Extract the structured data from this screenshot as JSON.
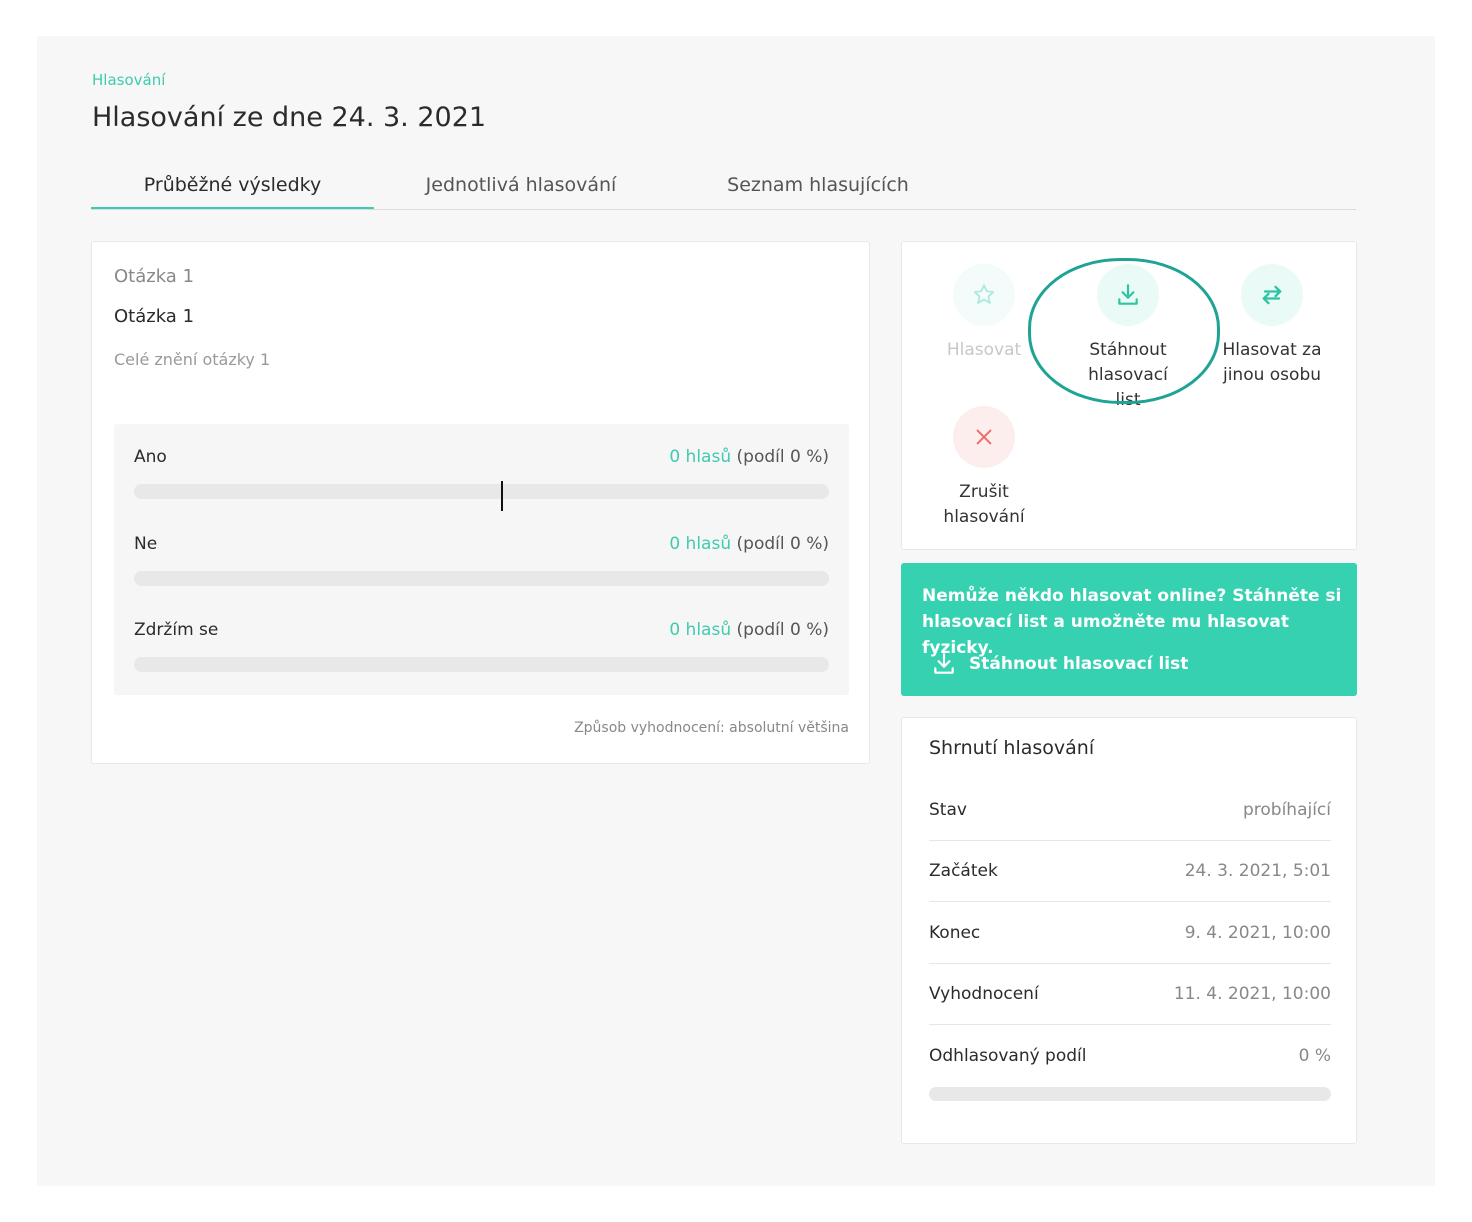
{
  "breadcrumb": "Hlasování",
  "title": "Hlasování ze dne 24. 3. 2021",
  "tabs": [
    {
      "label": "Průběžné výsledky",
      "active": true
    },
    {
      "label": "Jednotlivá hlasování",
      "active": false
    },
    {
      "label": "Seznam hlasujících",
      "active": false
    }
  ],
  "question": {
    "label": "Otázka 1",
    "title": "Otázka 1",
    "description": "Celé znění otázky 1",
    "options": [
      {
        "name": "Ano",
        "votes_link": "0 hlasů",
        "share": "(podíl 0 %)",
        "fraction": 0
      },
      {
        "name": "Ne",
        "votes_link": "0 hlasů",
        "share": "(podíl 0 %)",
        "fraction": 0
      },
      {
        "name": "Zdržím se",
        "votes_link": "0 hlasů",
        "share": "(podíl 0 %)",
        "fraction": 0
      }
    ],
    "method": "Způsob vyhodnocení: absolutní většina"
  },
  "actions": {
    "vote": "Hlasovat",
    "download_line1": "Stáhnout",
    "download_line2": "hlasovací list",
    "proxy_line1": "Hlasovat za",
    "proxy_line2": "jinou osobu",
    "cancel_line1": "Zrušit",
    "cancel_line2": "hlasování"
  },
  "banner": {
    "text": "Nemůže někdo hlasovat online? Stáhněte si hlasovací list a umožněte mu hlasovat fyzicky.",
    "link": "Stáhnout hlasovací list"
  },
  "summary": {
    "title": "Shrnutí hlasování",
    "rows": [
      {
        "key": "Stav",
        "value": "probíhající"
      },
      {
        "key": "Začátek",
        "value": "24. 3. 2021, 5:01"
      },
      {
        "key": "Konec",
        "value": "9. 4. 2021, 10:00"
      },
      {
        "key": "Vyhodnocení",
        "value": "11. 4. 2021, 10:00"
      },
      {
        "key": "Odhlasovaný podíl",
        "value": "0 %"
      }
    ],
    "progress_fraction": 0
  },
  "colors": {
    "accent": "#3ecbb0",
    "banner": "#35d1b0",
    "danger": "#f26b6b"
  }
}
